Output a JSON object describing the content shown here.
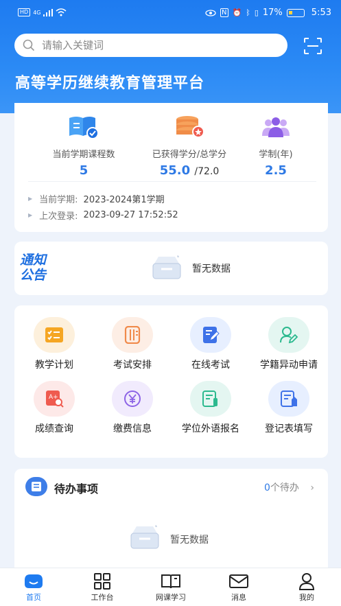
{
  "status_bar": {
    "network": "HD",
    "signal": "4G",
    "battery": "17%",
    "time": "5:53"
  },
  "search": {
    "placeholder": "请输入关键词"
  },
  "platform_title": "高等学历继续教育管理平台",
  "stats": [
    {
      "label": "当前学期课程数",
      "value": "5",
      "suffix": ""
    },
    {
      "label": "已获得学分/总学分",
      "value": "55.0",
      "suffix": "/72.0"
    },
    {
      "label": "学制(年)",
      "value": "2.5",
      "suffix": ""
    }
  ],
  "term_info": {
    "current_term_label": "当前学期:",
    "current_term_value": "2023-2024第1学期",
    "last_login_label": "上次登录:",
    "last_login_value": "2023-09-27 17:52:52"
  },
  "notice": {
    "badge_line1": "通知",
    "badge_line2": "公告",
    "empty_text": "暂无数据"
  },
  "functions": [
    {
      "label": "教学计划",
      "icon": "checklist-icon",
      "bg": "#fdf0dc",
      "color": "#f5a623"
    },
    {
      "label": "考试安排",
      "icon": "ruler-icon",
      "bg": "#fdeee5",
      "color": "#f08a4b"
    },
    {
      "label": "在线考试",
      "icon": "edit-doc-icon",
      "bg": "#e7efff",
      "color": "#3e72e8"
    },
    {
      "label": "学籍异动申请",
      "icon": "user-edit-icon",
      "bg": "#e4f6f1",
      "color": "#2bb98e"
    },
    {
      "label": "成绩查询",
      "icon": "score-search-icon",
      "bg": "#fde9e8",
      "color": "#ef5b4f"
    },
    {
      "label": "缴费信息",
      "icon": "yen-icon",
      "bg": "#f1ebfd",
      "color": "#8c63e6"
    },
    {
      "label": "学位外语报名",
      "icon": "form-icon",
      "bg": "#e4f6f1",
      "color": "#2bb98e"
    },
    {
      "label": "登记表填写",
      "icon": "register-form-icon",
      "bg": "#e7efff",
      "color": "#3e72e8"
    }
  ],
  "todo": {
    "title": "待办事项",
    "count": "0",
    "count_suffix": "个待办",
    "empty_text": "暂无数据"
  },
  "tabs": [
    {
      "label": "首页",
      "icon": "home-icon",
      "active": true
    },
    {
      "label": "工作台",
      "icon": "grid-icon",
      "active": false
    },
    {
      "label": "网课学习",
      "icon": "book-icon",
      "active": false
    },
    {
      "label": "消息",
      "icon": "mail-icon",
      "active": false
    },
    {
      "label": "我的",
      "icon": "user-icon",
      "active": false
    }
  ],
  "colors": {
    "primary": "#1e7bf0",
    "accent_value": "#2f7ae5"
  }
}
